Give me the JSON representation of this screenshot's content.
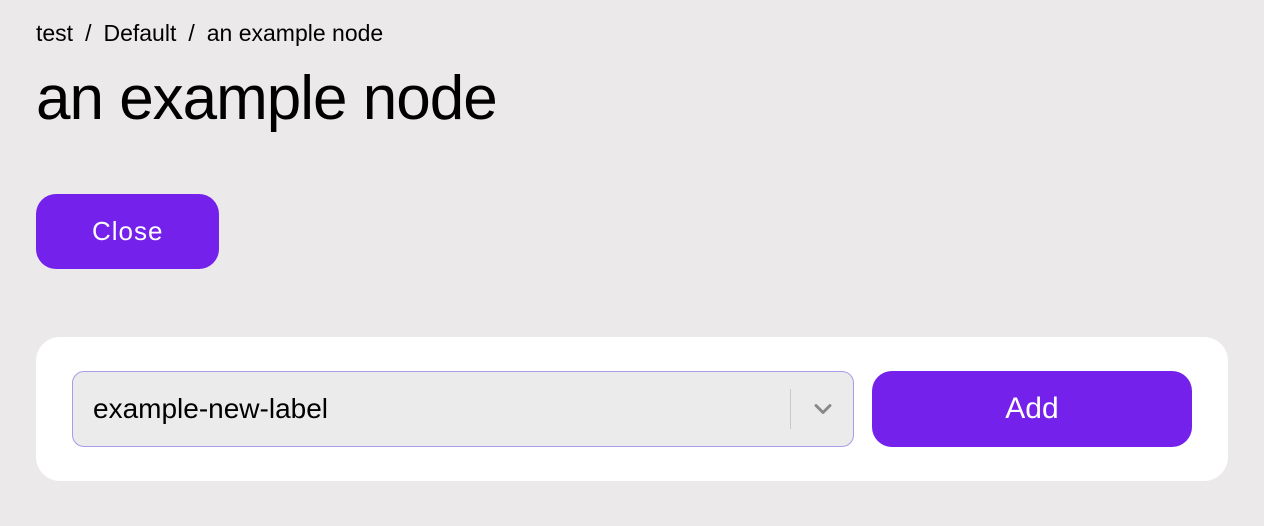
{
  "breadcrumb": {
    "items": [
      {
        "label": "test"
      },
      {
        "label": "Default"
      },
      {
        "label": "an example node"
      }
    ],
    "separator": "/"
  },
  "page": {
    "title": "an example node"
  },
  "actions": {
    "close_label": "Close"
  },
  "label_form": {
    "input_value": "example-new-label",
    "add_label": "Add"
  },
  "colors": {
    "accent": "#7321eb",
    "background": "#ece9eb",
    "card": "#ffffff",
    "input_bg": "#ebebeb",
    "input_border": "#a69de8"
  }
}
